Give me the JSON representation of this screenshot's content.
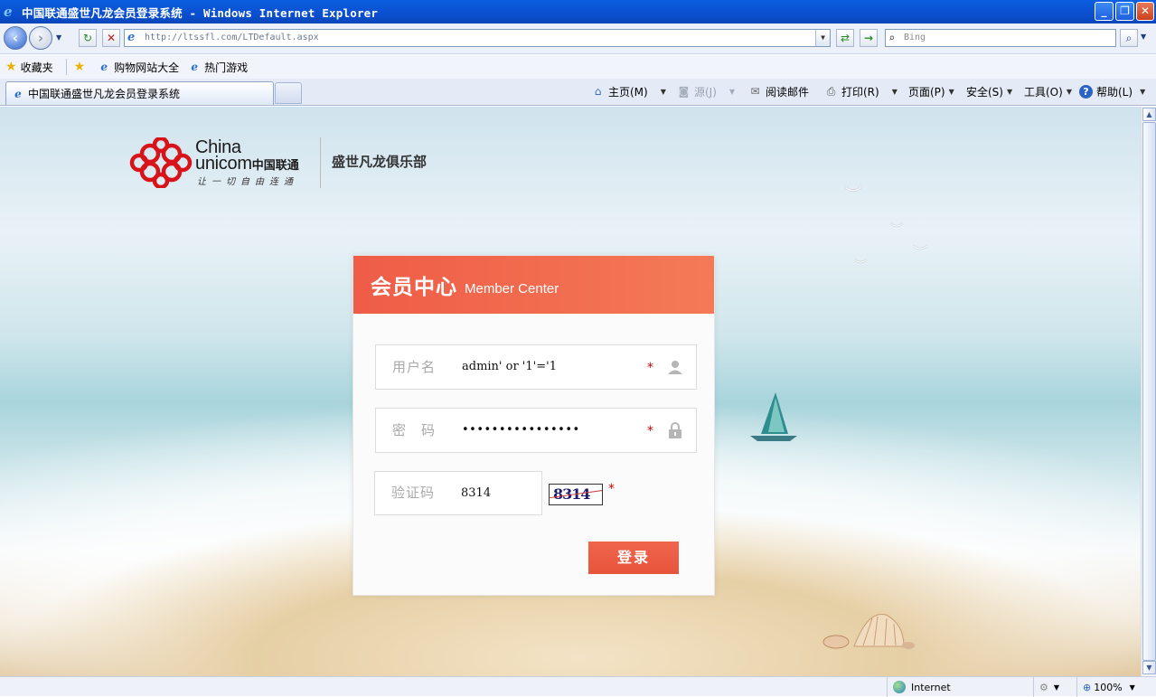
{
  "window": {
    "title": "中国联通盛世凡龙会员登录系统 - Windows Internet Explorer",
    "minimize": "_",
    "restore": "❐",
    "close": "✕"
  },
  "address": {
    "url": "http://ltssfl.com/LTDefault.aspx",
    "search_placeholder": "Bing"
  },
  "favorites": {
    "favorites_label": "收藏夹",
    "items": [
      "购物网站大全",
      "热门游戏"
    ]
  },
  "tabs": [
    {
      "label": "中国联通盛世凡龙会员登录系统"
    }
  ],
  "commandbar": {
    "home": "主页(M)",
    "feeds": "源(J)",
    "read_mail": "阅读邮件",
    "print": "打印(R)",
    "page": "页面(P)",
    "safety": "安全(S)",
    "tools": "工具(O)",
    "help": "帮助(L)"
  },
  "page": {
    "brand_en_line1": "China",
    "brand_en_line2": "unicom",
    "brand_cn": "中国联通",
    "brand_slogan": "让一切自由连通",
    "club_name": "盛世凡龙俱乐部",
    "panel_title_cn": "会员中心",
    "panel_title_en": "Member Center",
    "username_label": "用户名",
    "username_value": "admin' or '1'='1",
    "password_label": "密　码",
    "password_value": "••••••••••••••••",
    "captcha_label": "验证码",
    "captcha_value": "8314",
    "captcha_image_text": "8314",
    "required_mark": "*",
    "login_button": "登录"
  },
  "statusbar": {
    "zone": "Internet",
    "zoom": "100%"
  },
  "colors": {
    "accent": "#ef5c47",
    "titlebar": "#0a5fe0"
  }
}
